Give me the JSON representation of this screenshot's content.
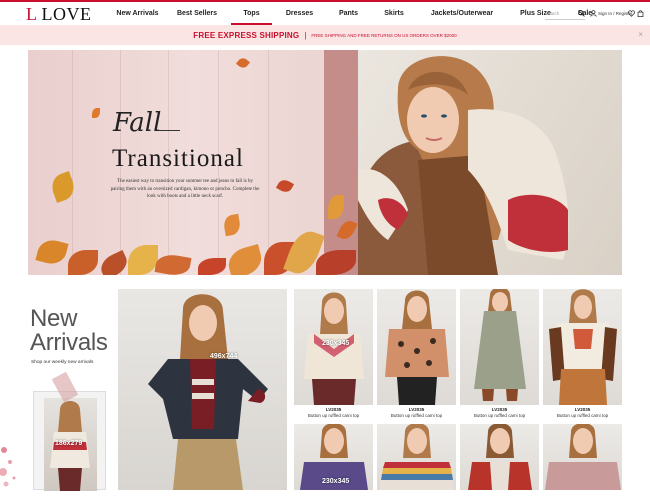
{
  "brand": {
    "logo_letter": "L",
    "logo_word": "LOVE"
  },
  "nav": {
    "items": [
      {
        "label": "New Arrivals",
        "width": 51
      },
      {
        "label": "Best Sellers",
        "width": 68
      },
      {
        "label": "Tops",
        "width": 41
      },
      {
        "label": "Dresses",
        "width": 55
      },
      {
        "label": "Pants",
        "width": 43
      },
      {
        "label": "Skirts",
        "width": 48
      },
      {
        "label": "Jackets/Outerwear",
        "width": 88
      },
      {
        "label": "Plus Size",
        "width": 59
      },
      {
        "label": "Sale",
        "width": 40
      }
    ],
    "active": "Tops"
  },
  "header": {
    "search_placeholder": "Search",
    "signin_label": "Sign In / Register"
  },
  "promo": {
    "main": "FREE EXPRESS SHIPPING",
    "separator": "|",
    "sub": "FREE SHIPPING AND FREE RETURNS ON US ORDERS OVER $2000",
    "close": "×"
  },
  "hero": {
    "script": "Fall",
    "title": "Transitional",
    "description": "The easiest way to transition your summer tee and jeans to fall is by pairing them with an oversized cardigan, kimono or poncho. Complete the look with boots and a little neck scarf."
  },
  "new_arrivals": {
    "title_line1": "New",
    "title_line2": "Arrivals",
    "subtitle": "Shop our weekly new arrivals",
    "small_card_dim": "186x279",
    "big_card_dim": "496x744"
  },
  "products": [
    {
      "sku": "LV2035",
      "name": "Button up ruffled cami top",
      "dim": "230x345"
    },
    {
      "sku": "LV2035",
      "name": "Button up ruffled cami top",
      "dim": ""
    },
    {
      "sku": "LV2035",
      "name": "Button up ruffled cami top",
      "dim": ""
    },
    {
      "sku": "LV2035",
      "name": "Button up ruffled cami top",
      "dim": ""
    }
  ],
  "products_row2": [
    {
      "dim": "230x345"
    },
    {
      "dim": ""
    },
    {
      "dim": ""
    },
    {
      "dim": ""
    }
  ],
  "colors": {
    "accent": "#c8102e",
    "promo_bg": "#fbe4e4"
  }
}
